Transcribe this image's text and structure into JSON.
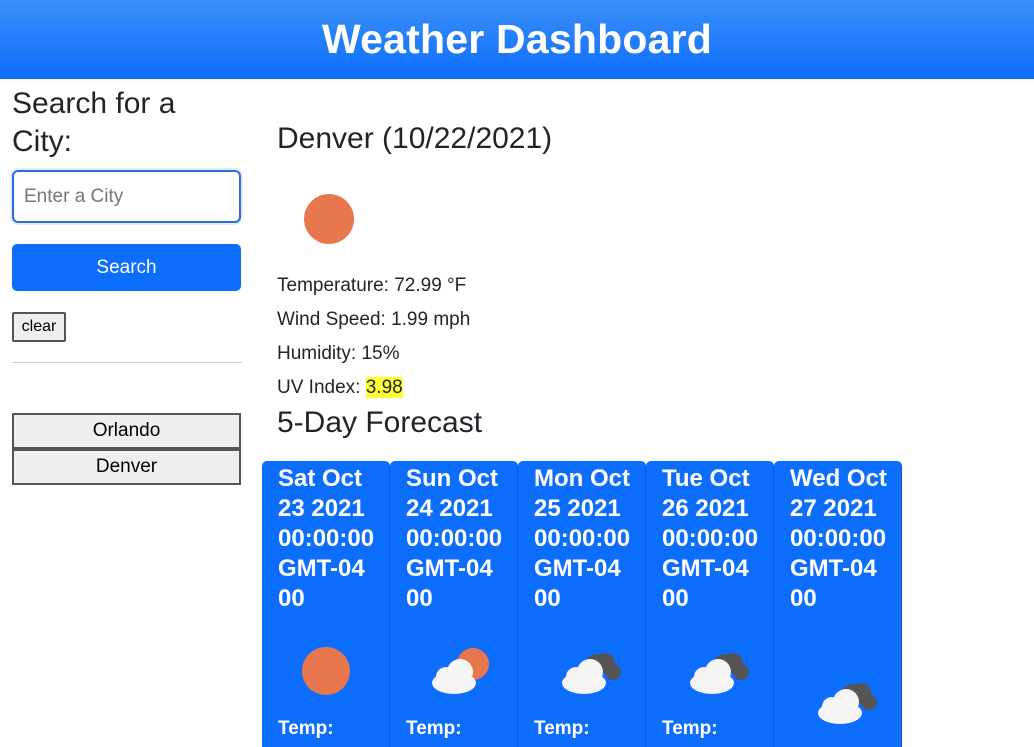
{
  "header": {
    "title": "Weather Dashboard"
  },
  "sidebar": {
    "heading": "Search for a City:",
    "search_placeholder": "Enter a City",
    "search_label": "Search",
    "clear_label": "clear",
    "history": [
      "Orlando",
      "Denver"
    ]
  },
  "current": {
    "title": "Denver (10/22/2021)",
    "icon": "sun-icon",
    "temperature": "Temperature: 72.99 °F",
    "wind": "Wind Speed: 1.99 mph",
    "humidity": "Humidity: 15%",
    "uv_label": "UV Index: ",
    "uv_value": "3.98",
    "uv_color": "#ffff33"
  },
  "forecast": {
    "title": "5-Day Forecast",
    "days": [
      {
        "date": "Sat Oct 23 2021 00:00:00 GMT-0400",
        "icon": "sun-icon",
        "temp_label": "Temp:"
      },
      {
        "date": "Sun Oct 24 2021 00:00:00 GMT-0400",
        "icon": "partly-cloudy-icon",
        "temp_label": "Temp:"
      },
      {
        "date": "Mon Oct 25 2021 00:00:00 GMT-0400",
        "icon": "cloudy-icon",
        "temp_label": "Temp:"
      },
      {
        "date": "Tue Oct 26 2021 00:00:00 GMT-0400",
        "icon": "cloudy-icon",
        "temp_label": "Temp:"
      },
      {
        "date": "Wed Oct 27 2021 00:00:00 GMT-0400",
        "icon": "cloudy-icon",
        "temp_label": "Temp:"
      }
    ]
  },
  "colors": {
    "primary": "#0d6efd",
    "sun": "#e8774d"
  }
}
